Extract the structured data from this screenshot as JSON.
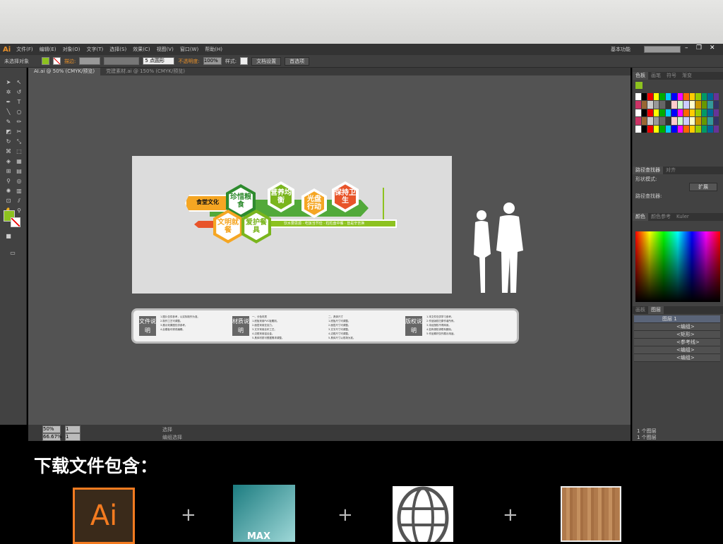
{
  "menubar": {
    "logo": "Ai",
    "items": [
      "文件(F)",
      "编辑(E)",
      "对象(O)",
      "文字(T)",
      "选择(S)",
      "效果(C)",
      "视图(V)",
      "窗口(W)",
      "帮助(H)"
    ],
    "workspace": "基本功能",
    "window_controls": [
      "minimize",
      "restore",
      "close"
    ]
  },
  "control_bar": {
    "selection": "未选择对象",
    "fill_color": "#8dc21f",
    "stroke_label": "描边:",
    "brush": "5 点圆形",
    "opacity_label": "不透明度:",
    "opacity": "100%",
    "style_label": "样式:",
    "doc_setup": "文档设置",
    "prefs": "首选项"
  },
  "tabs": [
    {
      "label": "AI.ai @ 50% (CMYK/预览)",
      "active": true
    },
    {
      "label": "党建素材.ai @ 150% (CMYK/预览)",
      "active": false
    }
  ],
  "artwork": {
    "banner_title": "食堂文化",
    "hexes": [
      {
        "text": "珍惜粮食",
        "color": "#2e8b2e"
      },
      {
        "text": "营养均衡",
        "color": "#7ab51d"
      },
      {
        "text": "光盘行动",
        "color": "#f5a623"
      },
      {
        "text": "保持卫生",
        "color": "#e8542a"
      },
      {
        "text": "文明就餐",
        "color": "#f5a623"
      },
      {
        "text": "爱护餐具",
        "color": "#7ab51d"
      }
    ],
    "slogan": "饮水要思源 · 吃饭当节俭 · 粒粒盘中餐 · 皆是辛苦换"
  },
  "info_panel": [
    {
      "badge": "文件说明",
      "lines": [
        "1.图片仅供参考，以实际制作为准。",
        "2.制作工艺可调整。",
        "3.展示效果图仅供参考。",
        "4.此模板可修改编辑。"
      ]
    },
    {
      "badge": "材质说明",
      "lines": [
        "一、分色材质",
        "1.底板采用PVC板雕刻。",
        "2.面层采用亚克力。",
        "3.文字采用丝印工艺。",
        "4.边框采用铝合金。",
        "5.具体材质可根据需求调整。"
      ]
    },
    {
      "badge": "",
      "lines": [
        "二、具体尺寸",
        "1.底板尺寸可调整。",
        "2.面层尺寸可调整。",
        "3.文字尺寸可调整。",
        "4.边框尺寸可调整。",
        "5.具体尺寸以现场为准。"
      ]
    },
    {
      "badge": "版权说明",
      "lines": [
        "1.本文件仅供学习参考。",
        "2.作品版权归原作者所有。",
        "3.未经授权不得商用。",
        "4.如有侵权请联系删除。",
        "5.作品素材仅作展示用途。"
      ]
    }
  ],
  "right_panel": {
    "swatch_tabs": [
      "色板",
      "画笔",
      "符号",
      "渐变"
    ],
    "pathfinder_tabs": [
      "路径查找器",
      "对齐"
    ],
    "shape_modes": "形状模式:",
    "expand": "扩展",
    "pathfinders": "路径查找器:",
    "color_tabs": [
      "颜色",
      "颜色参考",
      "Kuler"
    ],
    "layer_tabs": [
      "画板",
      "图层"
    ],
    "layers": [
      {
        "name": "图层 1",
        "expandable": true,
        "locked": false,
        "selected": true
      },
      {
        "name": "<编组>",
        "expandable": true,
        "locked": false
      },
      {
        "name": "<矩形>",
        "expandable": false,
        "locked": true
      },
      {
        "name": "<参考线>",
        "expandable": false,
        "locked": false
      },
      {
        "name": "<编组>",
        "expandable": true,
        "locked": true
      },
      {
        "name": "<编组>",
        "expandable": true,
        "locked": true
      }
    ],
    "layer_count": "1 个图层"
  },
  "status": [
    {
      "zoom": "50%",
      "page": "1",
      "label": "选择"
    },
    {
      "zoom": "66.67%",
      "page": "1",
      "label": "编组选择"
    }
  ],
  "bottom": {
    "title": "下载文件包含：",
    "files": [
      "Ai",
      "MAX",
      "globe",
      "wood"
    ],
    "plus": "+"
  }
}
